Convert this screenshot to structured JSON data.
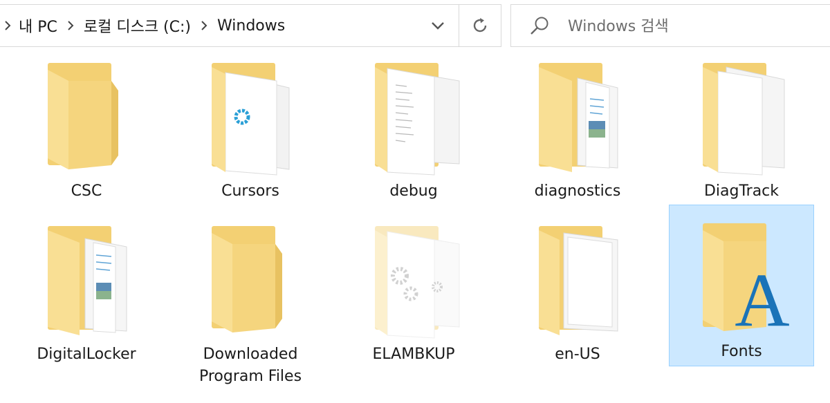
{
  "breadcrumb": [
    "내 PC",
    "로컬 디스크 (C:)",
    "Windows"
  ],
  "search": {
    "placeholder": "Windows 검색"
  },
  "icons": {
    "address_chevron": "chevron-right-icon",
    "dropdown": "chevron-down-icon",
    "refresh": "refresh-icon",
    "search": "search-icon"
  },
  "colors": {
    "selection_bg": "#cce8ff",
    "selection_border": "#99d1ff",
    "folder_back": "#f3d578",
    "folder_front": "#fbe59a",
    "fonts_letter": "#1a73b8"
  },
  "items": [
    {
      "label": "CSC",
      "content": "empty"
    },
    {
      "label": "Cursors",
      "content": "cursor"
    },
    {
      "label": "debug",
      "content": "text"
    },
    {
      "label": "diagnostics",
      "content": "photo"
    },
    {
      "label": "DiagTrack",
      "content": "papers"
    },
    {
      "label": "DigitalLocker",
      "content": "photo"
    },
    {
      "label": "Downloaded Program Files",
      "content": "empty"
    },
    {
      "label": "ELAMBKUP",
      "content": "gears",
      "faded": true
    },
    {
      "label": "en-US",
      "content": "papers"
    },
    {
      "label": "Fonts",
      "content": "font-letter",
      "selected": true,
      "letter": "A"
    }
  ]
}
